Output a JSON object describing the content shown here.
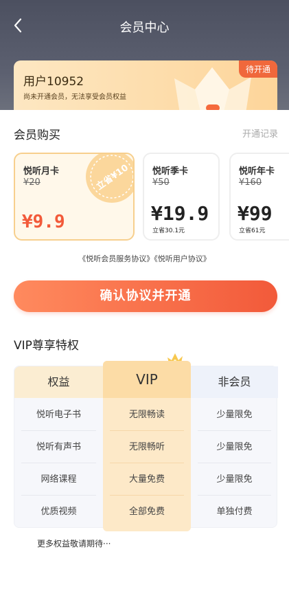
{
  "header": {
    "title": "会员中心"
  },
  "member_card": {
    "user": "用户10952",
    "description": "尚未开通会员，无法享受会员权益",
    "badge": "待开通"
  },
  "purchase": {
    "title": "会员购买",
    "records_link": "开通记录",
    "plans": [
      {
        "name": "悦听月卡",
        "original": "¥20",
        "price": "¥9.9",
        "save": "",
        "stamp": "立省¥10",
        "selected": true
      },
      {
        "name": "悦听季卡",
        "original": "¥50",
        "price": "¥19.9",
        "save": "立省30.1元",
        "selected": false
      },
      {
        "name": "悦听年卡",
        "original": "¥160",
        "price": "¥99",
        "save": "立省61元",
        "selected": false
      }
    ],
    "agreement_1": "《悦听会员服务协议》",
    "agreement_2": "《悦听用户协议》",
    "cta": "确认协议并开通"
  },
  "privileges": {
    "title": "VIP尊享特权",
    "headers": {
      "benefit": "权益",
      "vip": "VIP",
      "non_member": "非会员"
    },
    "rows": [
      {
        "benefit": "悦听电子书",
        "vip": "无限畅读",
        "non_member": "少量限免"
      },
      {
        "benefit": "悦听有声书",
        "vip": "无限畅听",
        "non_member": "少量限免"
      },
      {
        "benefit": "网络课程",
        "vip": "大量免费",
        "non_member": "少量限免"
      },
      {
        "benefit": "优质视频",
        "vip": "全部免费",
        "non_member": "单独付费"
      }
    ],
    "more": "更多权益敬请期待···"
  },
  "colors": {
    "accent": "#f25a3a",
    "gold": "#fcdca6",
    "header_dark": "#4c5060"
  }
}
